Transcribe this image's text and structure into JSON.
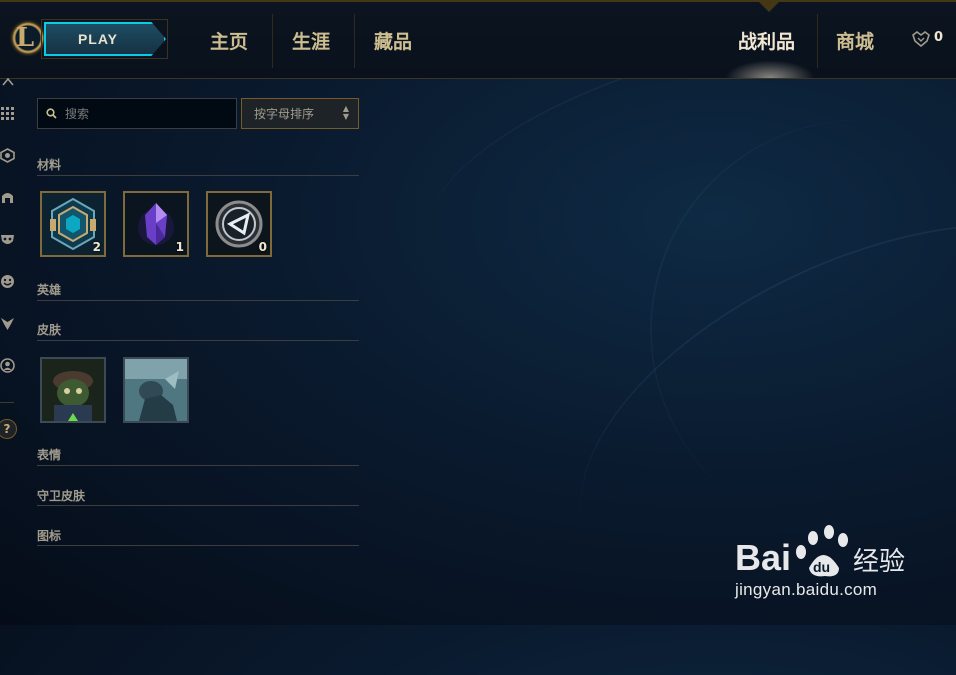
{
  "header": {
    "logo_letter": "L",
    "play_label": "PLAY",
    "tabs": [
      {
        "label": "主页"
      },
      {
        "label": "生涯"
      },
      {
        "label": "藏品"
      },
      {
        "label": "战利品",
        "active": true
      },
      {
        "label": "商城"
      }
    ],
    "rp_value": "0"
  },
  "search": {
    "placeholder": "搜索"
  },
  "sort": {
    "selected": "按字母排序"
  },
  "sections": {
    "materials": {
      "title": "材料",
      "items": [
        {
          "name": "hextech-chest",
          "count": "2"
        },
        {
          "name": "orange-essence-crystal",
          "count": "1"
        },
        {
          "name": "hextech-key",
          "count": "0"
        }
      ]
    },
    "champions": {
      "title": "英雄"
    },
    "skins": {
      "title": "皮肤",
      "items": [
        {
          "name": "skin-shard-1"
        },
        {
          "name": "skin-shard-2"
        }
      ]
    },
    "emotes": {
      "title": "表情"
    },
    "ward_skins": {
      "title": "守卫皮肤"
    },
    "icons": {
      "title": "图标"
    }
  },
  "watermark": {
    "brand": "Bai经验",
    "url": "jingyan.baidu.com"
  },
  "colors": {
    "gold": "#c8aa6e",
    "accent_blue": "#0acbe6",
    "bg": "#0a1a2e"
  }
}
